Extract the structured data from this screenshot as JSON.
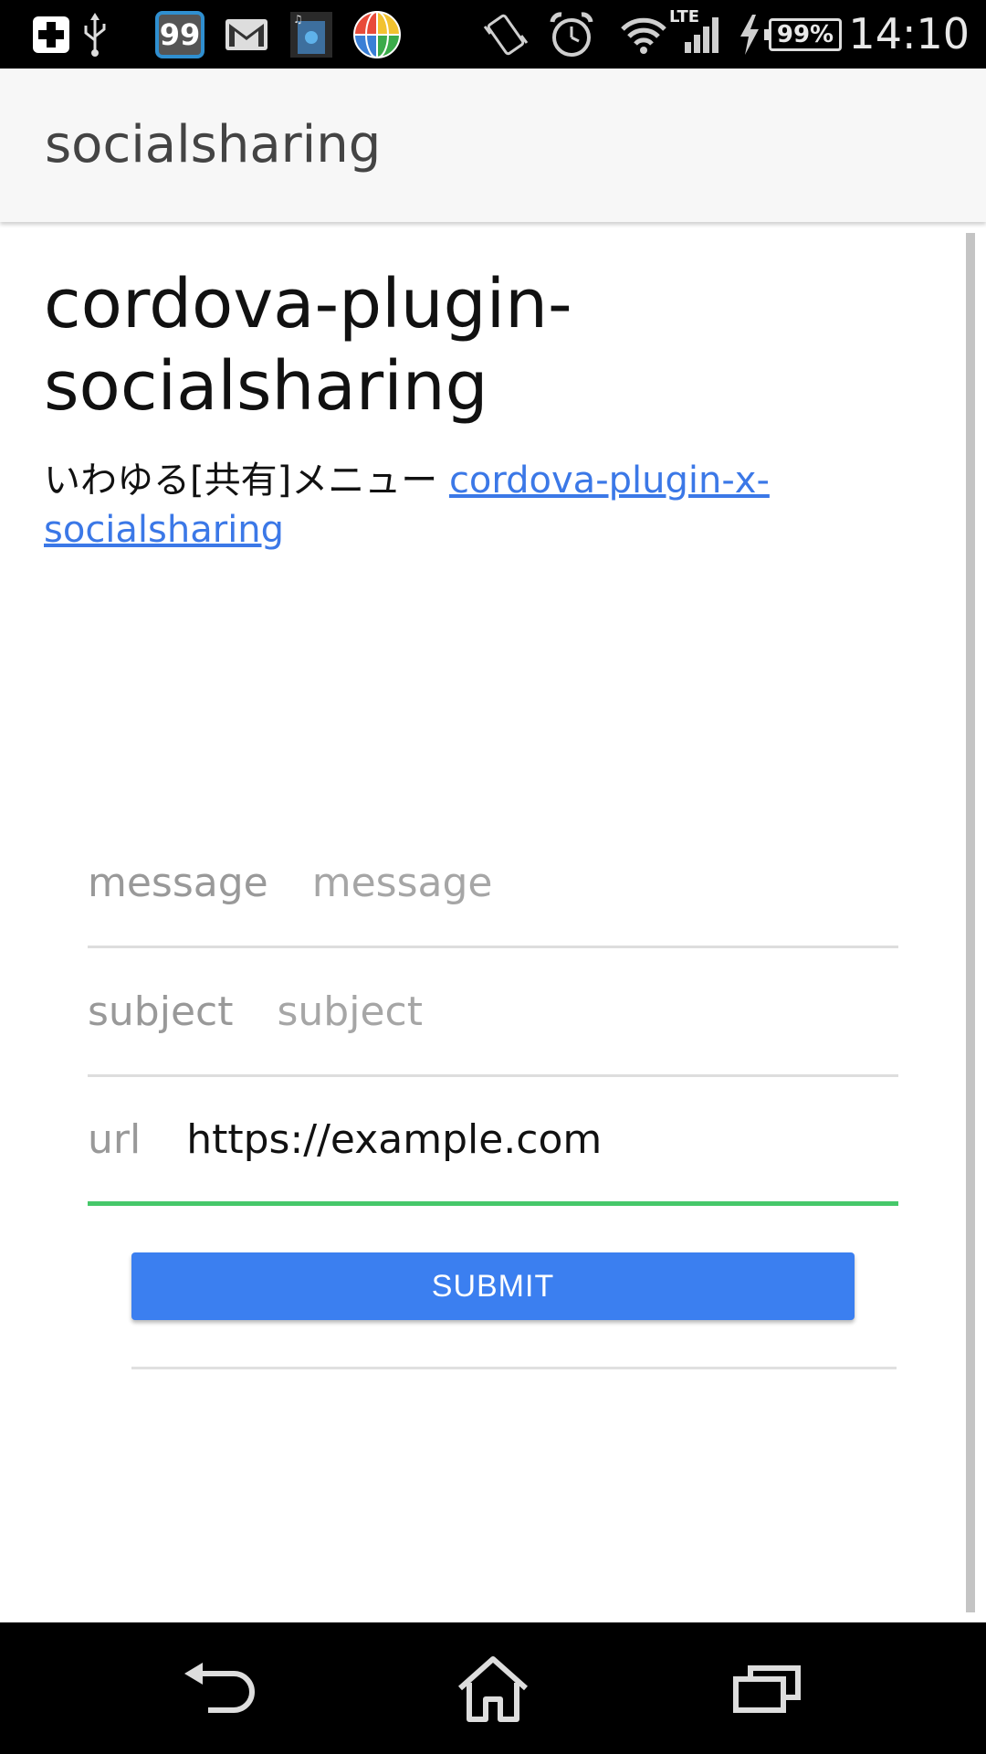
{
  "status_bar": {
    "time": "14:10",
    "battery": "99%",
    "network": "LTE",
    "badge_count": "99",
    "icons": [
      "plus-app-icon",
      "usb-icon",
      "badge-99-icon",
      "gmail-icon",
      "twitter-music-icon",
      "globe-app-icon",
      "vibrate-icon",
      "alarm-icon",
      "wifi-icon",
      "signal-icon",
      "charging-icon",
      "battery-icon"
    ]
  },
  "action_bar": {
    "title": "socialsharing"
  },
  "main": {
    "heading": "cordova-plugin-socialsharing",
    "intro_text": "いわゆる[共有]メニュー ",
    "intro_link": "cordova-plugin-x-socialsharing",
    "form": {
      "message": {
        "label": "message",
        "placeholder": "message",
        "value": ""
      },
      "subject": {
        "label": "subject",
        "placeholder": "subject",
        "value": ""
      },
      "url": {
        "label": "url",
        "placeholder": "",
        "value": "https://example.com"
      }
    },
    "submit_label": "SUBMIT"
  },
  "nav_bar": {
    "icons": [
      "back-icon",
      "home-icon",
      "recent-apps-icon"
    ]
  },
  "colors": {
    "accent": "#3b7ff0",
    "link": "#3b78e7",
    "active_underline": "#46c86a"
  }
}
